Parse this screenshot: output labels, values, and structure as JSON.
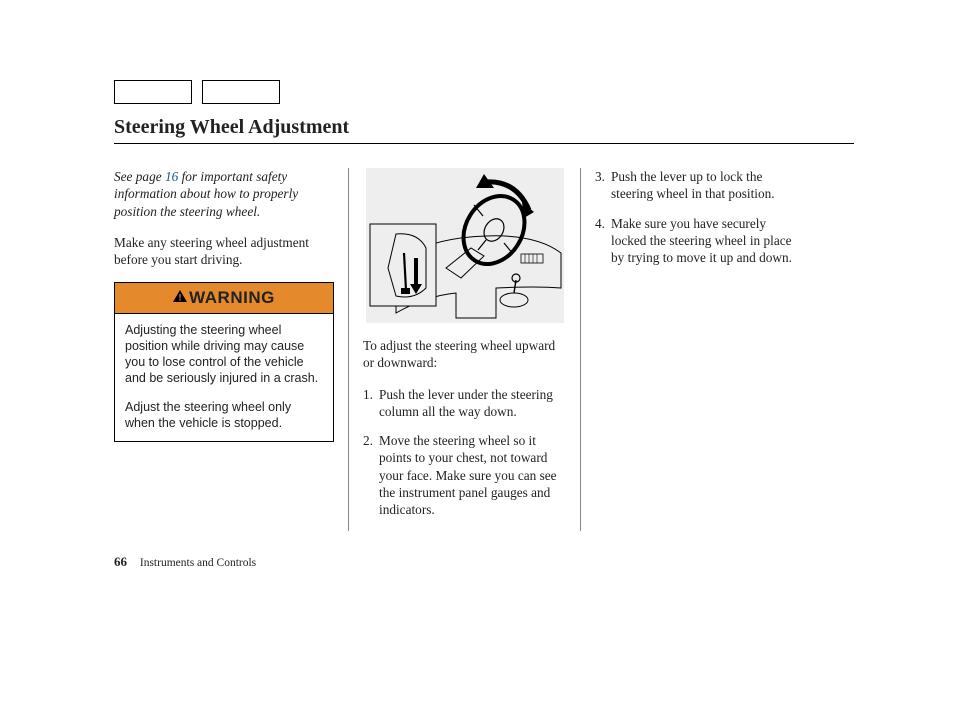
{
  "title": "Steering Wheel Adjustment",
  "col1": {
    "safety_prefix": "See page ",
    "safety_page": "16",
    "safety_suffix": " for important safety information about how to properly position the steering wheel.",
    "intro": "Make any steering wheel adjustment before you start driving.",
    "warning_label": "WARNING",
    "warning_p1": "Adjusting the steering wheel position while driving may cause you to lose control of the vehicle and be seriously injured in a crash.",
    "warning_p2": "Adjust the steering wheel only when the vehicle is stopped."
  },
  "col2": {
    "lead": "To adjust the steering wheel upward or downward:",
    "step1_n": "1.",
    "step1": "Push the lever under the steering column all the way down.",
    "step2_n": "2.",
    "step2": "Move the steering wheel so it points to your chest, not toward your face. Make sure you can see the instrument panel gauges and indicators."
  },
  "col3": {
    "step3_n": "3.",
    "step3": "Push the lever up to lock the steering wheel in that position.",
    "step4_n": "4.",
    "step4": "Make sure you have securely locked the steering wheel in place by trying to move it up and down."
  },
  "footer": {
    "page_number": "66",
    "section": "Instruments and Controls"
  }
}
